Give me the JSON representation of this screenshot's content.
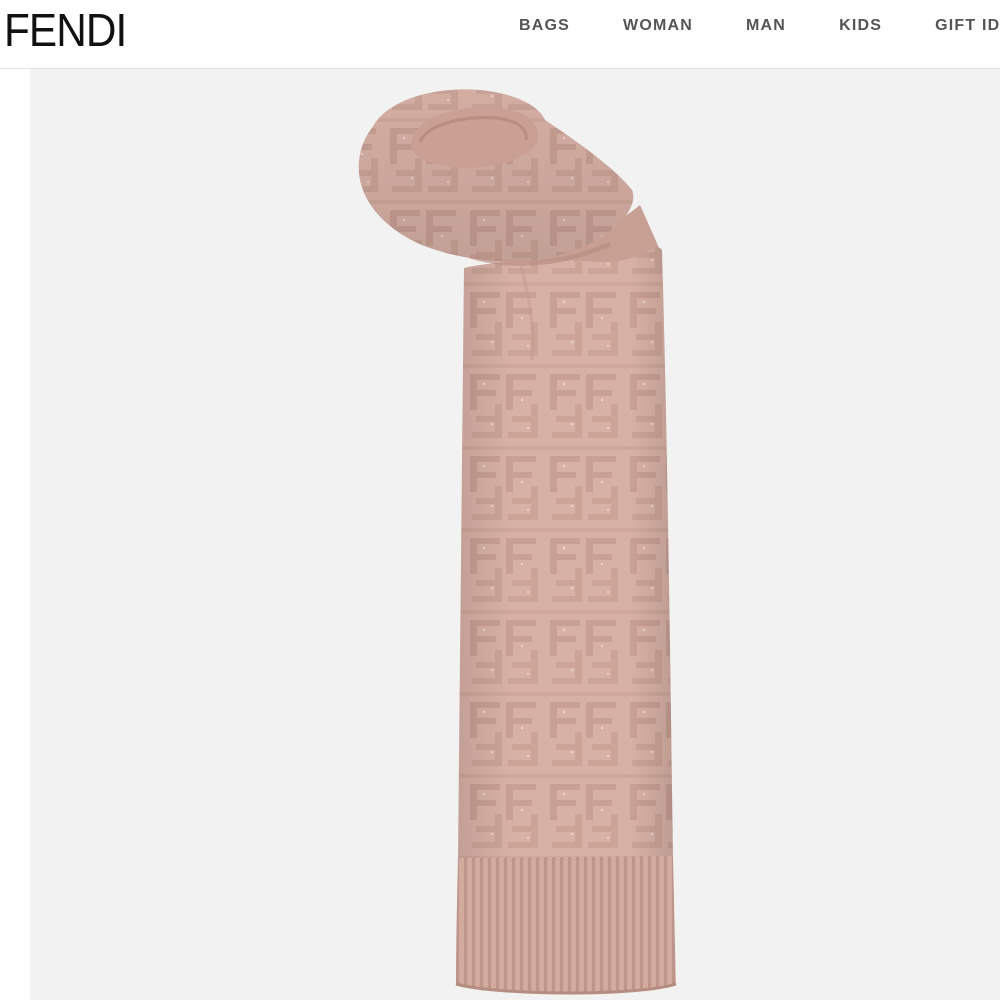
{
  "header": {
    "logo": "FENDI",
    "nav": [
      {
        "label": "BAGS"
      },
      {
        "label": "WOMAN"
      },
      {
        "label": "MAN"
      },
      {
        "label": "KIDS"
      },
      {
        "label": "GIFT ID"
      }
    ]
  },
  "product": {
    "image_icon": "knit-scarf-image",
    "colors": {
      "background": "#f2f2f2",
      "knit": "#d8b1a6",
      "knit_shadow": "#c29a8e",
      "knit_highlight": "#e6c5bb"
    }
  }
}
